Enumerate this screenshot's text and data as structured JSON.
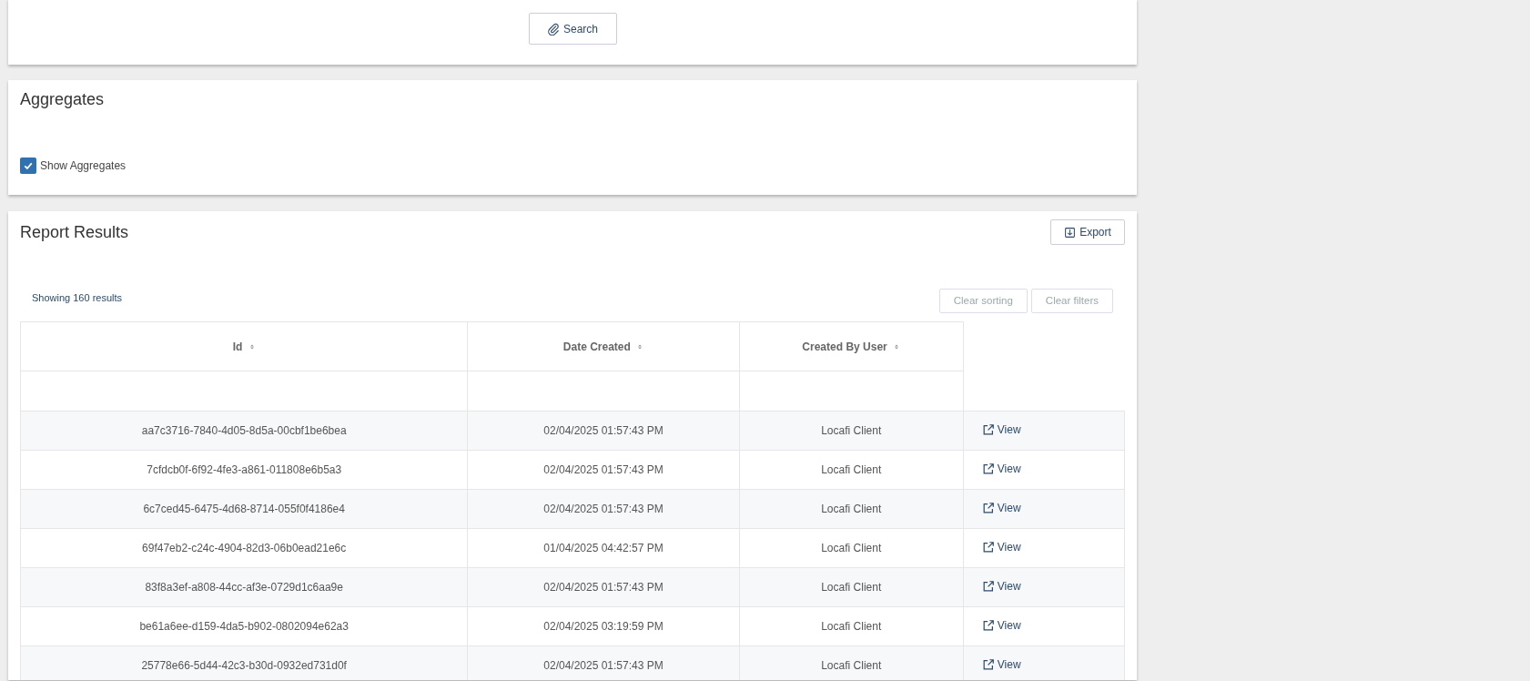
{
  "search_panel": {
    "search_button": "Search"
  },
  "aggregates": {
    "title": "Aggregates",
    "show_aggregates": {
      "label": "Show Aggregates",
      "checked": true
    }
  },
  "report_results": {
    "title": "Report Results",
    "export_button": "Export",
    "result_count": "Showing 160 results",
    "clear_buttons": [
      {
        "label": "Clear sorting",
        "disabled": true
      },
      {
        "label": "Clear filters",
        "disabled": true
      }
    ],
    "columns": [
      "Id",
      "Date Created",
      "Created By User"
    ],
    "rows": [
      {
        "id": "aa7c3716-7840-4d05-8d5a-00cbf1be6bea",
        "date_created": "02/04/2025 01:57:43 PM",
        "created_by_user": "Locafi Client",
        "action": "View"
      },
      {
        "id": "7cfdcb0f-6f92-4fe3-a861-011808e6b5a3",
        "date_created": "02/04/2025 01:57:43 PM",
        "created_by_user": "Locafi Client",
        "action": "View"
      },
      {
        "id": "6c7ced45-6475-4d68-8714-055f0f4186e4",
        "date_created": "02/04/2025 01:57:43 PM",
        "created_by_user": "Locafi Client",
        "action": "View"
      },
      {
        "id": "69f47eb2-c24c-4904-82d3-06b0ead21e6c",
        "date_created": "01/04/2025 04:42:57 PM",
        "created_by_user": "Locafi Client",
        "action": "View"
      },
      {
        "id": "83f8a3ef-a808-44cc-af3e-0729d1c6aa9e",
        "date_created": "02/04/2025 01:57:43 PM",
        "created_by_user": "Locafi Client",
        "action": "View"
      },
      {
        "id": "be61a6ee-d159-4da5-b902-0802094e62a3",
        "date_created": "02/04/2025 03:19:59 PM",
        "created_by_user": "Locafi Client",
        "action": "View"
      },
      {
        "id": "25778e66-5d44-42c3-b30d-0932ed731d0f",
        "date_created": "02/04/2025 01:57:43 PM",
        "created_by_user": "Locafi Client",
        "action": "View"
      }
    ]
  }
}
